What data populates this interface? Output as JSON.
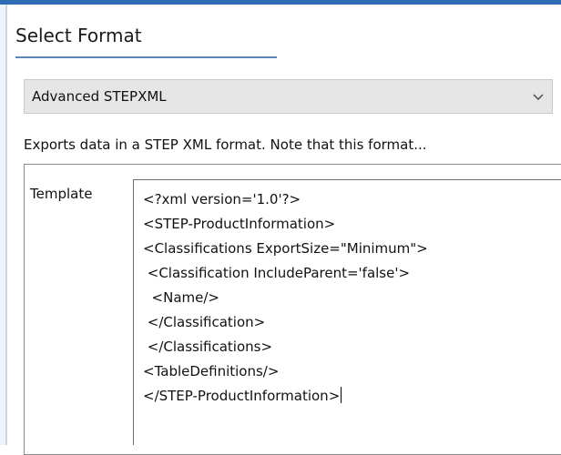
{
  "section": {
    "title": "Select Format"
  },
  "format_select": {
    "selected": "Advanced STEPXML",
    "icon": "chevron-down-icon"
  },
  "description": "Exports data in a STEP XML format. Note that this format...",
  "template": {
    "label": "Template",
    "lines": [
      "<?xml version='1.0'?>",
      "<STEP-ProductInformation>",
      "<Classifications ExportSize=\"Minimum\">",
      " <Classification IncludeParent='false'>",
      "  <Name/>",
      " </Classification>",
      " </Classifications>",
      "<TableDefinitions/>",
      "</STEP-ProductInformation>"
    ]
  },
  "colors": {
    "accent": "#2e6db4",
    "underline": "#5d86b5",
    "select_bg": "#e6e6e6"
  }
}
